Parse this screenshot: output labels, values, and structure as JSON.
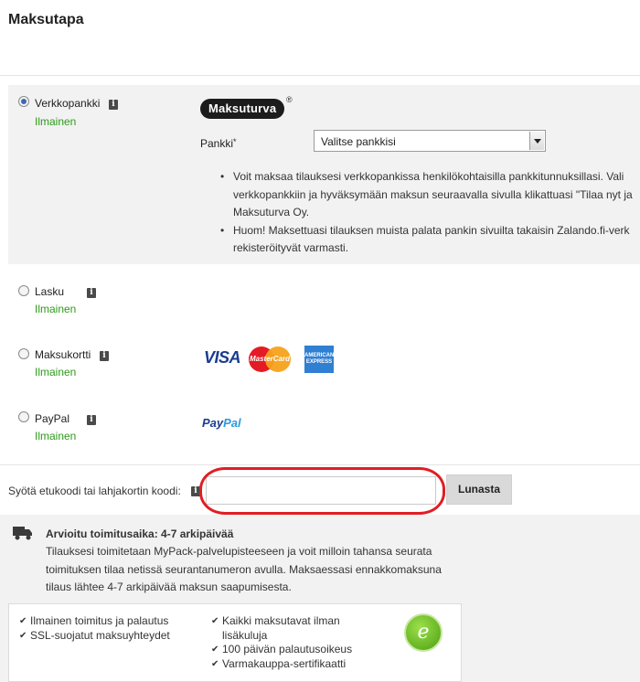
{
  "page": {
    "title": "Maksutapa"
  },
  "payment_methods": [
    {
      "label": "Verkkopankki",
      "price": "Ilmainen",
      "selected": true
    },
    {
      "label": "Lasku",
      "price": "Ilmainen",
      "selected": false
    },
    {
      "label": "Maksukortti",
      "price": "Ilmainen",
      "selected": false
    },
    {
      "label": "PayPal",
      "price": "Ilmainen",
      "selected": false
    }
  ],
  "info_icon_glyph": "i",
  "icons": {
    "info": "info-icon",
    "radio": "radio-button",
    "truck": "truck-icon",
    "check": "checkmark-icon"
  },
  "bank": {
    "provider_logo": "Maksuturva",
    "registered_mark": "®",
    "label": "Pankki",
    "required_mark": "*",
    "selected_value": "Valitse pankkisi",
    "notes": [
      "Voit maksaa tilauksesi verkkopankissa henkilökohtaisilla pankkitunnuksillasi. Vali",
      "verkkopankkiin ja hyväksymään maksun seuraavalla sivulla klikattuasi \"Tilaa nyt ja",
      "Maksuturva Oy.",
      "Huom! Maksettuasi tilauksen muista palata pankin sivuilta takaisin Zalando.fi-verk",
      "rekisteröityvät varmasti."
    ]
  },
  "card_logos": {
    "visa": "VISA",
    "mastercard": "MasterCard",
    "amex": "AMERICAN EXPRESS"
  },
  "paypal_logo": {
    "part1": "Pay",
    "part2": "Pal"
  },
  "coupon": {
    "label": "Syötä etukoodi tai lahjakortin koodi:",
    "value": "",
    "button_label": "Lunasta"
  },
  "delivery": {
    "title": "Arvioitu toimitusaika: 4-7 arkipäivää",
    "text": "Tilauksesi toimitetaan MyPack-palvelupisteeseen ja voit milloin tahansa seurata toimituksen tilaa netissä seurantanumeron avulla. Maksaessasi ennakkomaksuna tilaus lähtee 4-7 arkipäivää maksun saapumisesta."
  },
  "benefits": {
    "col1": [
      "Ilmainen toimitus ja palautus",
      "SSL-suojatut maksuyhteydet"
    ],
    "col2": [
      "Kaikki maksutavat ilman lisäkuluja",
      "100 päivän palautusoikeus",
      "Varmakauppa-sertifikaatti"
    ],
    "seal_glyph": "e"
  },
  "colors": {
    "free_green": "#2f9a1c",
    "highlight_red": "#e01e24",
    "selected_bg": "#f2f2f2"
  }
}
